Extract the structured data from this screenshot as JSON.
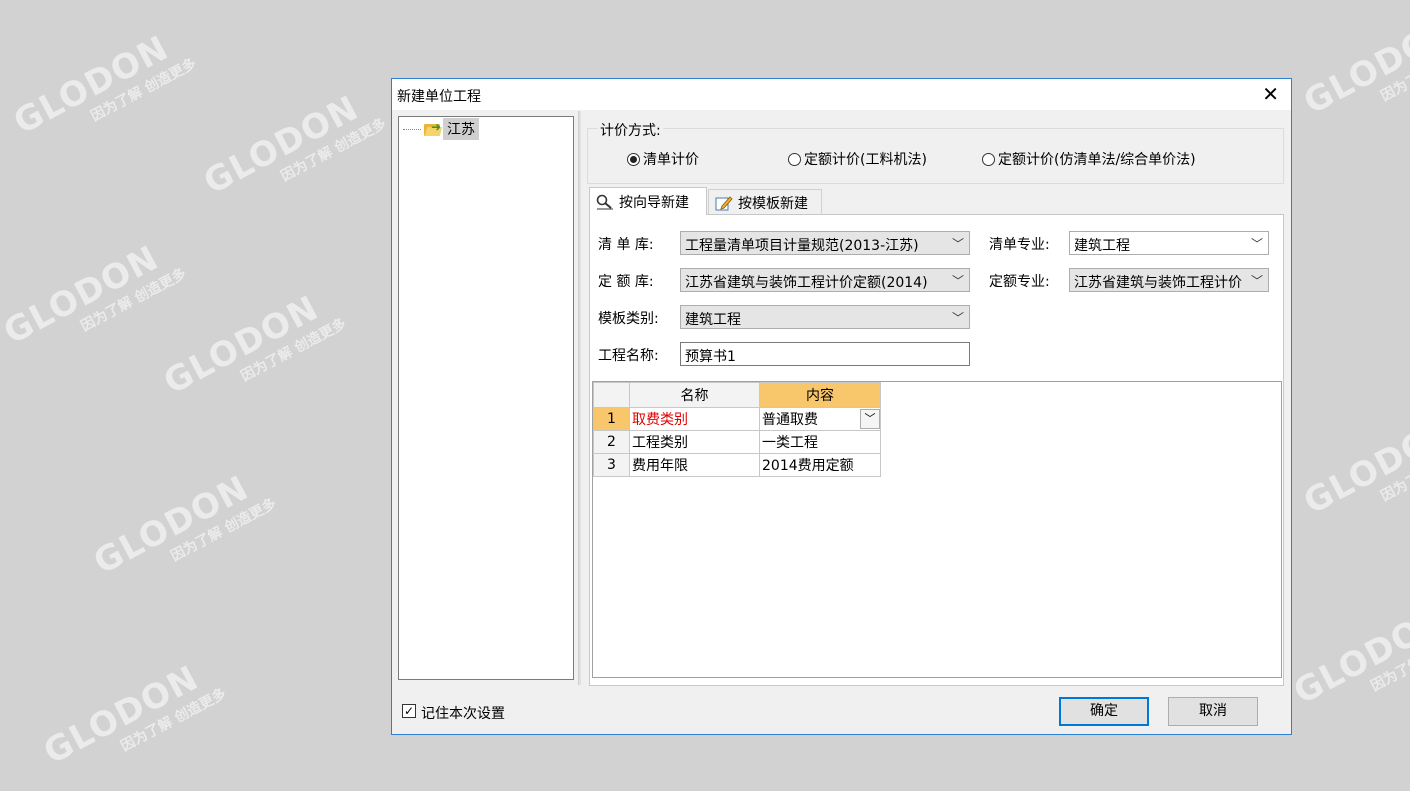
{
  "watermark": {
    "brand": "GLODON",
    "cn_brand": "广联达",
    "slogan": "因为了解 创造更多"
  },
  "dialog": {
    "title": "新建单位工程",
    "close_glyph": "✕"
  },
  "tree": {
    "root_label": "江苏",
    "icon": "folder-open-icon"
  },
  "pricing": {
    "title": "计价方式:",
    "options": [
      {
        "label": "清单计价",
        "selected": true
      },
      {
        "label": "定额计价(工料机法)",
        "selected": false
      },
      {
        "label": "定额计价(仿清单法/综合单价法)",
        "selected": false
      }
    ]
  },
  "tabs": [
    {
      "label": "按向导新建",
      "icon": "magnifier-icon",
      "active": true
    },
    {
      "label": "按模板新建",
      "icon": "edit-pencil-icon",
      "active": false
    }
  ],
  "form": {
    "list_lib_label": "清 单 库:",
    "list_lib_value": "工程量清单项目计量规范(2013-江苏)",
    "list_major_label": "清单专业:",
    "list_major_value": "建筑工程",
    "quota_lib_label": "定 额 库:",
    "quota_lib_value": "江苏省建筑与装饰工程计价定额(2014)",
    "quota_major_label": "定额专业:",
    "quota_major_value": "江苏省建筑与装饰工程计价",
    "template_label": "模板类别:",
    "template_value": "建筑工程",
    "name_label": "工程名称:",
    "name_value": "预算书1"
  },
  "grid": {
    "headers": [
      "名称",
      "内容"
    ],
    "rows": [
      {
        "num": "1",
        "name": "取费类别",
        "value": "普通取费",
        "highlight": true
      },
      {
        "num": "2",
        "name": "工程类别",
        "value": "一类工程",
        "highlight": false
      },
      {
        "num": "3",
        "name": "费用年限",
        "value": "2014费用定额",
        "highlight": false
      }
    ]
  },
  "footer": {
    "remember_label": "记住本次设置",
    "remember_checked": true,
    "ok_label": "确定",
    "cancel_label": "取消"
  },
  "colors": {
    "accent": "#0078d7",
    "highlight_header": "#f8c66b",
    "required_text": "#e00000"
  }
}
